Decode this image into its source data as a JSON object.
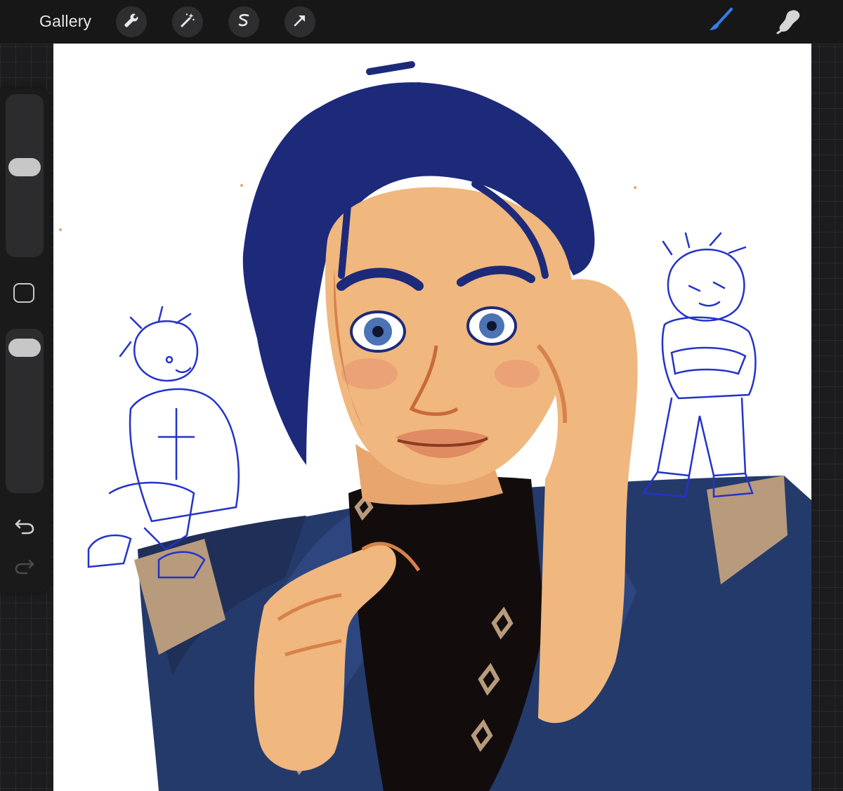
{
  "toolbar": {
    "gallery_label": "Gallery",
    "left_tools": [
      "wrench-icon",
      "magic-wand-icon",
      "selection-icon",
      "transform-arrow-icon"
    ],
    "right_tools": [
      "brush-icon",
      "smudge-icon"
    ],
    "active_tool": "brush",
    "accent_color": "#2f7fe8"
  },
  "sidebar": {
    "brush_size_fraction": 0.56,
    "opacity_fraction": 0.95,
    "controls": [
      "brush-size-slider",
      "modify-button",
      "opacity-slider",
      "undo-button",
      "redo-button"
    ],
    "redo_enabled": false
  },
  "canvas": {
    "background": "#ffffff",
    "palette": {
      "hair": "#1d2a7a",
      "skin": "#f0b77e",
      "skin_shadow": "#d7824a",
      "jacket": "#243a6b",
      "shirt": "#120d0c",
      "epaulette": "#b89a7c",
      "sketch": "#2433c8"
    }
  }
}
